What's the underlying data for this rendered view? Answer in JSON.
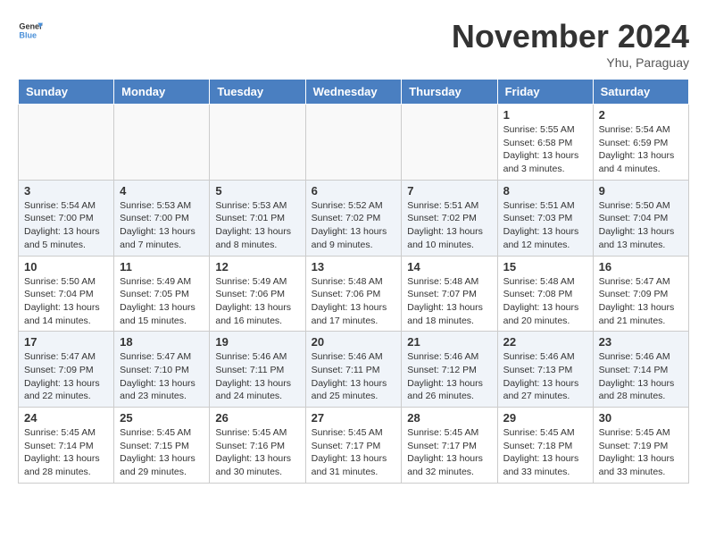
{
  "header": {
    "logo_general": "General",
    "logo_blue": "Blue",
    "title": "November 2024",
    "location": "Yhu, Paraguay"
  },
  "weekdays": [
    "Sunday",
    "Monday",
    "Tuesday",
    "Wednesday",
    "Thursday",
    "Friday",
    "Saturday"
  ],
  "weeks": [
    [
      {
        "day": "",
        "info": ""
      },
      {
        "day": "",
        "info": ""
      },
      {
        "day": "",
        "info": ""
      },
      {
        "day": "",
        "info": ""
      },
      {
        "day": "",
        "info": ""
      },
      {
        "day": "1",
        "info": "Sunrise: 5:55 AM\nSunset: 6:58 PM\nDaylight: 13 hours and 3 minutes."
      },
      {
        "day": "2",
        "info": "Sunrise: 5:54 AM\nSunset: 6:59 PM\nDaylight: 13 hours and 4 minutes."
      }
    ],
    [
      {
        "day": "3",
        "info": "Sunrise: 5:54 AM\nSunset: 7:00 PM\nDaylight: 13 hours and 5 minutes."
      },
      {
        "day": "4",
        "info": "Sunrise: 5:53 AM\nSunset: 7:00 PM\nDaylight: 13 hours and 7 minutes."
      },
      {
        "day": "5",
        "info": "Sunrise: 5:53 AM\nSunset: 7:01 PM\nDaylight: 13 hours and 8 minutes."
      },
      {
        "day": "6",
        "info": "Sunrise: 5:52 AM\nSunset: 7:02 PM\nDaylight: 13 hours and 9 minutes."
      },
      {
        "day": "7",
        "info": "Sunrise: 5:51 AM\nSunset: 7:02 PM\nDaylight: 13 hours and 10 minutes."
      },
      {
        "day": "8",
        "info": "Sunrise: 5:51 AM\nSunset: 7:03 PM\nDaylight: 13 hours and 12 minutes."
      },
      {
        "day": "9",
        "info": "Sunrise: 5:50 AM\nSunset: 7:04 PM\nDaylight: 13 hours and 13 minutes."
      }
    ],
    [
      {
        "day": "10",
        "info": "Sunrise: 5:50 AM\nSunset: 7:04 PM\nDaylight: 13 hours and 14 minutes."
      },
      {
        "day": "11",
        "info": "Sunrise: 5:49 AM\nSunset: 7:05 PM\nDaylight: 13 hours and 15 minutes."
      },
      {
        "day": "12",
        "info": "Sunrise: 5:49 AM\nSunset: 7:06 PM\nDaylight: 13 hours and 16 minutes."
      },
      {
        "day": "13",
        "info": "Sunrise: 5:48 AM\nSunset: 7:06 PM\nDaylight: 13 hours and 17 minutes."
      },
      {
        "day": "14",
        "info": "Sunrise: 5:48 AM\nSunset: 7:07 PM\nDaylight: 13 hours and 18 minutes."
      },
      {
        "day": "15",
        "info": "Sunrise: 5:48 AM\nSunset: 7:08 PM\nDaylight: 13 hours and 20 minutes."
      },
      {
        "day": "16",
        "info": "Sunrise: 5:47 AM\nSunset: 7:09 PM\nDaylight: 13 hours and 21 minutes."
      }
    ],
    [
      {
        "day": "17",
        "info": "Sunrise: 5:47 AM\nSunset: 7:09 PM\nDaylight: 13 hours and 22 minutes."
      },
      {
        "day": "18",
        "info": "Sunrise: 5:47 AM\nSunset: 7:10 PM\nDaylight: 13 hours and 23 minutes."
      },
      {
        "day": "19",
        "info": "Sunrise: 5:46 AM\nSunset: 7:11 PM\nDaylight: 13 hours and 24 minutes."
      },
      {
        "day": "20",
        "info": "Sunrise: 5:46 AM\nSunset: 7:11 PM\nDaylight: 13 hours and 25 minutes."
      },
      {
        "day": "21",
        "info": "Sunrise: 5:46 AM\nSunset: 7:12 PM\nDaylight: 13 hours and 26 minutes."
      },
      {
        "day": "22",
        "info": "Sunrise: 5:46 AM\nSunset: 7:13 PM\nDaylight: 13 hours and 27 minutes."
      },
      {
        "day": "23",
        "info": "Sunrise: 5:46 AM\nSunset: 7:14 PM\nDaylight: 13 hours and 28 minutes."
      }
    ],
    [
      {
        "day": "24",
        "info": "Sunrise: 5:45 AM\nSunset: 7:14 PM\nDaylight: 13 hours and 28 minutes."
      },
      {
        "day": "25",
        "info": "Sunrise: 5:45 AM\nSunset: 7:15 PM\nDaylight: 13 hours and 29 minutes."
      },
      {
        "day": "26",
        "info": "Sunrise: 5:45 AM\nSunset: 7:16 PM\nDaylight: 13 hours and 30 minutes."
      },
      {
        "day": "27",
        "info": "Sunrise: 5:45 AM\nSunset: 7:17 PM\nDaylight: 13 hours and 31 minutes."
      },
      {
        "day": "28",
        "info": "Sunrise: 5:45 AM\nSunset: 7:17 PM\nDaylight: 13 hours and 32 minutes."
      },
      {
        "day": "29",
        "info": "Sunrise: 5:45 AM\nSunset: 7:18 PM\nDaylight: 13 hours and 33 minutes."
      },
      {
        "day": "30",
        "info": "Sunrise: 5:45 AM\nSunset: 7:19 PM\nDaylight: 13 hours and 33 minutes."
      }
    ]
  ]
}
